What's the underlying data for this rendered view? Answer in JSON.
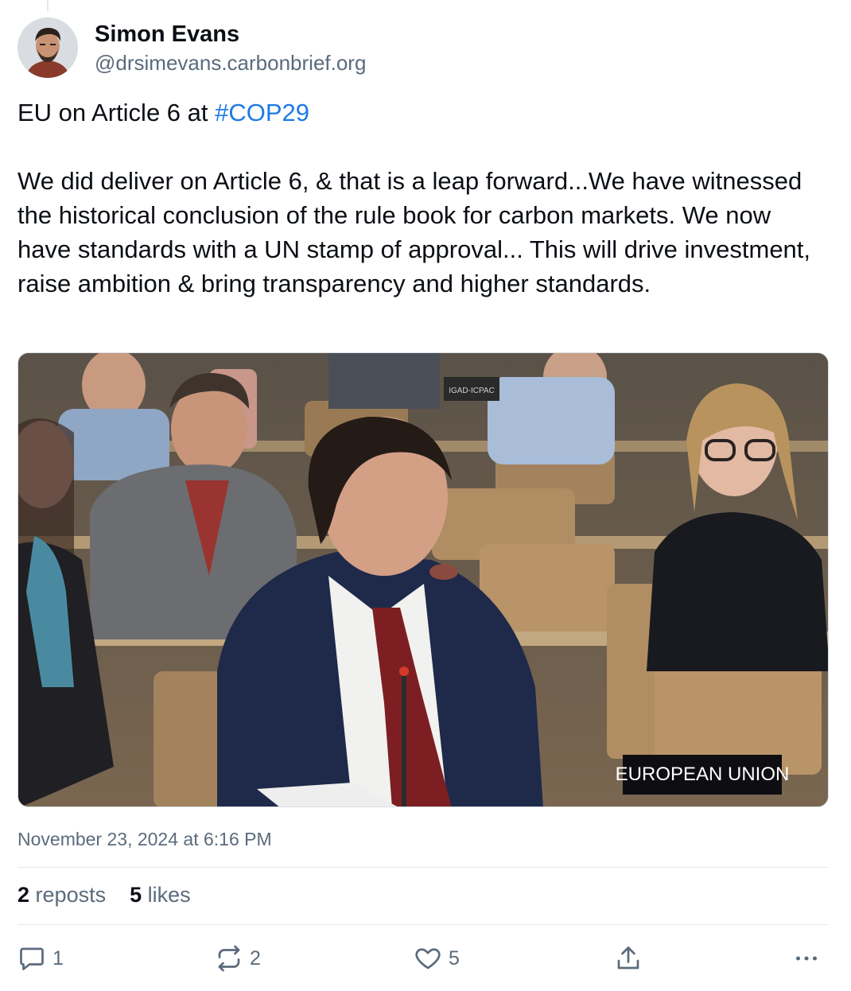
{
  "author": {
    "display_name": "Simon Evans",
    "handle": "@drsimevans.carbonbrief.org"
  },
  "post": {
    "line1_prefix": "EU on Article 6 at ",
    "hashtag": "#COP29",
    "body": "We did deliver on Article 6, & that is a leap forward...We have witnessed the historical conclusion of the rule book for carbon markets. We now have standards with a UN stamp of approval... This will drive investment, raise ambition & bring transparency and higher standards.",
    "timestamp": "November 23, 2024 at 6:16 PM"
  },
  "image": {
    "nameplate": "EUROPEAN UNION",
    "placard": "IGAD-ICPAC"
  },
  "stats": {
    "reposts_count": "2",
    "reposts_label": "reposts",
    "likes_count": "5",
    "likes_label": "likes"
  },
  "actions": {
    "reply_count": "1",
    "repost_count": "2",
    "like_count": "5",
    "icons": [
      "reply-icon",
      "repost-icon",
      "heart-icon",
      "share-icon",
      "more-icon"
    ]
  },
  "colors": {
    "accent": "#1d7be6",
    "muted": "#5b6b7c",
    "divider": "#e3e8ee"
  }
}
